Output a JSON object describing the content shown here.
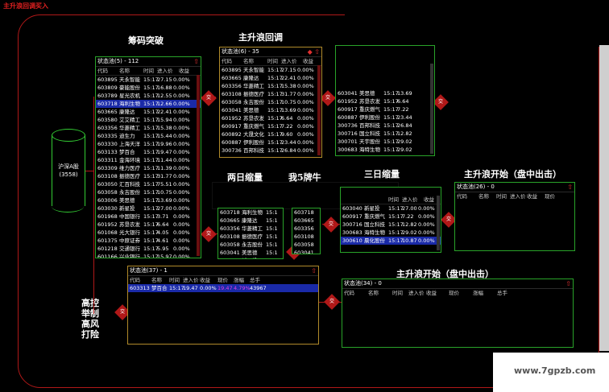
{
  "app_title": "主升浪回调买入",
  "headers": {
    "chouma": "筹码突破",
    "zhushenglang_huitiao": "主升浪回调",
    "liangri": "两日缩量",
    "wo5": "我5牌牛",
    "sanri": "三日缩量",
    "zhushenglang_kaishi1": "主升浪开始（盘中出击）",
    "zhushenglang_kaishi2": "主升浪开始（盘中出击）",
    "gaokong": "高控举制高风打险"
  },
  "cylinder": {
    "line1": "沪深A股",
    "line2": "(3558)"
  },
  "col_headers": {
    "code": "代码",
    "name": "名称",
    "time": "时间",
    "price": "进入价",
    "gain": "收益",
    "now": "现价",
    "change": "涨幅",
    "total": "总手"
  },
  "badge_label": "交",
  "panels": {
    "p1": {
      "title": "状态池(5) - 112",
      "rows": [
        [
          "603895",
          "天永智能",
          "15:17",
          "27.15",
          "0.00%"
        ],
        [
          "603809",
          "豪能股份",
          "15:17",
          "16.88",
          "0.00%"
        ],
        [
          "603789",
          "星光农机",
          "15:17",
          "12.55",
          "0.00%"
        ],
        [
          "603718",
          "海利生物",
          "15:17",
          "12.66",
          "0.00%"
        ],
        [
          "603665",
          "康隆达",
          "15:17",
          "22.41",
          "0.00%"
        ],
        [
          "603580",
          "艾艾精工",
          "15:17",
          "15.94",
          "0.00%"
        ],
        [
          "603356",
          "华菱精工",
          "15:17",
          "15.38",
          "0.00%"
        ],
        [
          "603335",
          "迪生力",
          "15:17",
          "15.44",
          "0.00%"
        ],
        [
          "603330",
          "上海天洋",
          "15:17",
          "19.96",
          "0.00%"
        ],
        [
          "603133",
          "梦百合",
          "15:17",
          "19.47",
          "0.00%"
        ],
        [
          "603311",
          "金海环境",
          "15:17",
          "11.44",
          "0.00%"
        ],
        [
          "603309",
          "维力医疗",
          "15:17",
          "11.39",
          "0.00%"
        ],
        [
          "603108",
          "振德医疗",
          "15:17",
          "31.77",
          "0.00%"
        ],
        [
          "603050",
          "汇百科技",
          "15:17",
          "75.51",
          "0.00%"
        ],
        [
          "603058",
          "永吉股份",
          "15:17",
          "10.75",
          "0.00%"
        ],
        [
          "603006",
          "美思德",
          "15:17",
          "13.69",
          "0.00%"
        ],
        [
          "603030",
          "新星投",
          "15:17",
          "27.00",
          "0.00%"
        ],
        [
          "601968",
          "中国银行",
          "15:17",
          "3.71",
          "0.00%"
        ],
        [
          "601952",
          "苏垦农发",
          "15:17",
          "6.64",
          "0.00%"
        ],
        [
          "601068",
          "光大银行",
          "15:17",
          "4.05",
          "0.00%"
        ],
        [
          "601375",
          "中原证券",
          "15:17",
          "4.61",
          "0.00%"
        ],
        [
          "601218",
          "交通银行",
          "15:17",
          "5.95",
          "0.00%"
        ],
        [
          "601166",
          "兴业银行",
          "15:17",
          "15.97",
          "0.00%"
        ]
      ]
    },
    "p2": {
      "title": "状态池(6) - 35",
      "rows": [
        [
          "603895",
          "天永智能",
          "15:17",
          "27.15",
          "0.00%"
        ],
        [
          "603665",
          "康隆达",
          "15:17",
          "22.41",
          "0.00%"
        ],
        [
          "603356",
          "华菱精工",
          "15:17",
          "15.38",
          "0.00%"
        ],
        [
          "603108",
          "振德医疗",
          "15:17",
          "31.77",
          "0.00%"
        ],
        [
          "603058",
          "永吉股份",
          "15:17",
          "10.75",
          "0.00%"
        ],
        [
          "603041",
          "美思德",
          "15:17",
          "13.69",
          "0.00%"
        ],
        [
          "601952",
          "苏垦农发",
          "15:17",
          "6.64",
          "0.00%"
        ],
        [
          "600917",
          "重庆燃气",
          "15:17",
          "7.22",
          "0.00%"
        ],
        [
          "600892",
          "大晟文化",
          "15:17",
          "9.60",
          "0.00%"
        ],
        [
          "600887",
          "伊利股份",
          "15:17",
          "23.44",
          "0.00%"
        ],
        [
          "300736",
          "百邦科技",
          "15:17",
          "26.84",
          "0.00%"
        ]
      ]
    },
    "p3": {
      "rows": [
        [
          "603041",
          "美思德",
          "15:17",
          "13.69"
        ],
        [
          "601952",
          "苏垦农发",
          "15:17",
          "6.64"
        ],
        [
          "600917",
          "重庆燃气",
          "15:17",
          "7.22"
        ],
        [
          "600887",
          "伊利股份",
          "15:17",
          "23.44"
        ],
        [
          "300736",
          "百邦科技",
          "15:17",
          "26.84"
        ],
        [
          "300716",
          "国立科技",
          "15:17",
          "12.82"
        ],
        [
          "300701",
          "天宇股份",
          "15:17",
          "29.02"
        ],
        [
          "300683",
          "海特生物",
          "15:17",
          "29.02"
        ]
      ]
    },
    "p4": {
      "rows": [
        [
          "603718",
          "海利生物",
          "15:1"
        ],
        [
          "603665",
          "康隆达",
          "15:1"
        ],
        [
          "603356",
          "华菱精工",
          "15:1"
        ],
        [
          "603108",
          "振德医疗",
          "15:1"
        ],
        [
          "603058",
          "永吉股份",
          "15:1"
        ],
        [
          "603041",
          "美思德",
          "15:1"
        ],
        [
          "603040",
          "新星投",
          "15:1"
        ]
      ]
    },
    "p5": {
      "rows": [
        [
          "603718"
        ],
        [
          "603665"
        ],
        [
          "603356"
        ],
        [
          "603108"
        ],
        [
          "603058"
        ],
        [
          "603041"
        ]
      ]
    },
    "p6": {
      "rows": [
        [
          "603040",
          "新星投",
          "15:17",
          "27.00",
          "0.00%"
        ],
        [
          "600917",
          "重庆燃气",
          "15:17",
          "7.22",
          "0.00%"
        ],
        [
          "300716",
          "国立科技",
          "15:17",
          "12.82",
          "0.00%"
        ],
        [
          "300683",
          "海特生物",
          "15:17",
          "29.02",
          "0.00%"
        ],
        [
          "300610",
          "晨化股份",
          "15:17",
          "10.87",
          "0.00%"
        ]
      ]
    },
    "p7": {
      "title": "状态池(26) - 0"
    },
    "p8": {
      "title": "状态池(37) - 1",
      "row": [
        "603313",
        "梦百合",
        "15:17",
        "19.47",
        "0.00%",
        "19.47",
        "4.79%",
        "43967"
      ]
    },
    "p9": {
      "title": "状态池(34) - 0"
    }
  },
  "watermark": "www.7gpzb.com"
}
